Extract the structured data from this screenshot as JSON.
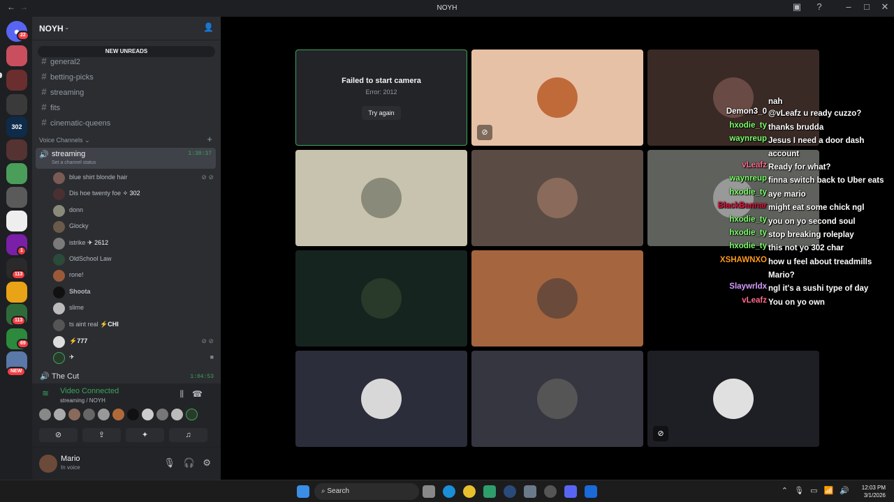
{
  "window": {
    "title": "NOYH",
    "back_icon": "←",
    "fwd_icon": "→"
  },
  "guilds": {
    "home_badge": "22",
    "badges": [
      "1",
      "113",
      "113",
      "69"
    ],
    "new_label": "NEW",
    "server_labels": [
      "302"
    ]
  },
  "server": {
    "name": "NOYH"
  },
  "new_unreads": "NEW UNREADS",
  "text_channels": [
    "general2",
    "betting-picks",
    "streaming",
    "fits",
    "cinematic-queens"
  ],
  "voice_category": "Voice Channels",
  "active_voice": {
    "name": "streaming",
    "status": "Set a channel status",
    "time": "1:38:37"
  },
  "members": [
    {
      "name": "blue shirt blonde hair",
      "tag": ""
    },
    {
      "name": "Dis hoe twenty foe",
      "tag": "302"
    },
    {
      "name": "donn",
      "tag": ""
    },
    {
      "name": "Glocky",
      "tag": ""
    },
    {
      "name": "istrike",
      "tag": "2612"
    },
    {
      "name": "OldSchool Law",
      "tag": ""
    },
    {
      "name": "rone!",
      "tag": ""
    },
    {
      "name": "Shoota",
      "tag": ""
    },
    {
      "name": "slime",
      "tag": ""
    },
    {
      "name": "ts aint real",
      "tag": "CHI"
    },
    {
      "name": "777",
      "tag": ""
    },
    {
      "name": "✈",
      "tag": ""
    }
  ],
  "other_voice": {
    "name": "The Cut",
    "time": "1:04:53"
  },
  "voice_panel": {
    "status": "Video Connected",
    "location": "streaming / NOYH"
  },
  "user": {
    "name": "Mario",
    "status": "In voice"
  },
  "camera_error": {
    "title": "Failed to start camera",
    "error": "Error: 2012",
    "button": "Try again"
  },
  "chat": [
    {
      "user": "",
      "msg": "nah",
      "color": "#ff5a5a"
    },
    {
      "user": "Demon3_0",
      "msg": "@vLeafz u ready cuzzo?",
      "color": "#ffffff"
    },
    {
      "user": "hxodie_ty",
      "msg": "thanks brudda",
      "color": "#7cff6a"
    },
    {
      "user": "waynreup",
      "msg": "Jesus I need a door dash account",
      "color": "#7cff6a"
    },
    {
      "user": "vLeafz",
      "msg": "Ready for what?",
      "color": "#ff6a8a"
    },
    {
      "user": "waynreup",
      "msg": "finna switch back to Uber eats",
      "color": "#7cff6a"
    },
    {
      "user": "hxodie_ty",
      "msg": "aye mario",
      "color": "#7cff6a"
    },
    {
      "user": "BlackBannar",
      "msg": "might eat some chick ngl",
      "color": "#e0103a"
    },
    {
      "user": "hxodie_ty",
      "msg": "you on yo second soul",
      "color": "#7cff6a"
    },
    {
      "user": "hxodie_ty",
      "msg": "stop breaking roleplay",
      "color": "#7cff6a"
    },
    {
      "user": "hxodie_ty",
      "msg": "this not yo 302 char",
      "color": "#7cff6a"
    },
    {
      "user": "XSHAWNXO",
      "msg": "how u feel about treadmills Mario?",
      "color": "#ff9a1a"
    },
    {
      "user": "Slaywrldx",
      "msg": "ngl it's a sushi type of day",
      "color": "#d59cff"
    },
    {
      "user": "vLeafz",
      "msg": "You on yo own",
      "color": "#ff6a8a"
    }
  ],
  "taskbar": {
    "search": "Search",
    "time": "12:03 PM",
    "date": "3/1/2026"
  },
  "colors": {
    "accent_green": "#3ba55c",
    "sidebar_bg": "#2b2d31",
    "guild_bg": "#1e1f22",
    "stage_bg": "#000000"
  }
}
